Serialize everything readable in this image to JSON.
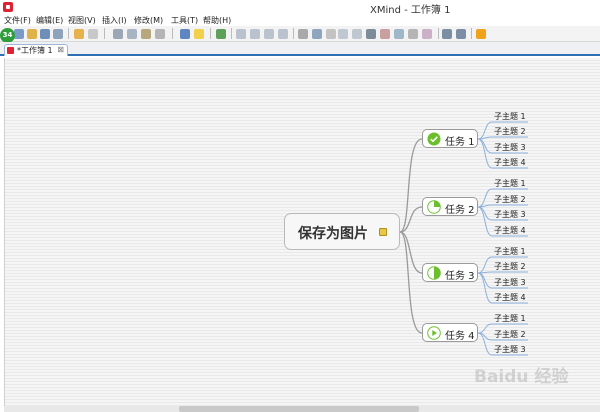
{
  "window": {
    "title": "XMind - 工作簿 1"
  },
  "menu": [
    "文件(F)",
    "编辑(E)",
    "视图(V)",
    "插入(I)",
    "修改(M)",
    "工具(T)",
    "帮助(H)"
  ],
  "badge": "34",
  "tab": {
    "label": "*工作簿 1",
    "close": "⊠"
  },
  "central_topic": "保存为图片",
  "topics": [
    {
      "label": "任务 1",
      "status": "complete",
      "color": "#6cbf2c",
      "subs": [
        "子主题 1",
        "子主题 2",
        "子主题 3",
        "子主题 4"
      ]
    },
    {
      "label": "任务 2",
      "status": "quarter",
      "color": "#6cbf2c",
      "subs": [
        "子主题 1",
        "子主题 2",
        "子主题 3",
        "子主题 4"
      ]
    },
    {
      "label": "任务 3",
      "status": "half",
      "color": "#6cbf2c",
      "subs": [
        "子主题 1",
        "子主题 2",
        "子主题 3",
        "子主题 4"
      ]
    },
    {
      "label": "任务 4",
      "status": "start",
      "color": "#6cbf2c",
      "subs": [
        "子主题 1",
        "子主题 2",
        "子主题 3"
      ]
    }
  ],
  "watermark": "Baidu 经验"
}
